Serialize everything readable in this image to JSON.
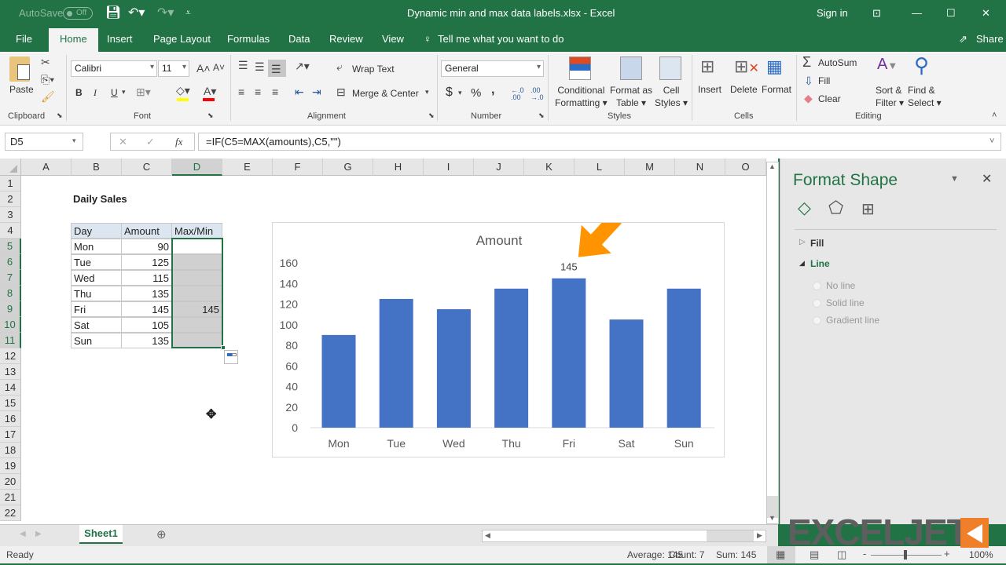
{
  "titlebar": {
    "autosave_label": "AutoSave",
    "autosave_state": "Off",
    "title": "Dynamic min and max data labels.xlsx  -  Excel",
    "sign_in": "Sign in"
  },
  "tabs": [
    "File",
    "Home",
    "Insert",
    "Page Layout",
    "Formulas",
    "Data",
    "Review",
    "View"
  ],
  "active_tab": "Home",
  "tell_me": "Tell me what you want to do",
  "share": "Share",
  "ribbon": {
    "clipboard": {
      "paste": "Paste",
      "label": "Clipboard"
    },
    "font": {
      "name": "Calibri",
      "size": "11",
      "label": "Font",
      "bold": "B",
      "italic": "I",
      "underline": "U",
      "fill_color": "#ffff00",
      "font_color": "#ff0000"
    },
    "alignment": {
      "wrap": "Wrap Text",
      "merge": "Merge & Center",
      "label": "Alignment"
    },
    "number": {
      "format": "General",
      "currency": "$",
      "percent": "%",
      "comma": ",",
      "label": "Number"
    },
    "styles": {
      "conditional": [
        "Conditional",
        "Formatting ▾"
      ],
      "table": [
        "Format as",
        "Table ▾"
      ],
      "cell": [
        "Cell",
        "Styles ▾"
      ],
      "label": "Styles"
    },
    "cells": {
      "insert": "Insert",
      "delete": "Delete",
      "format": "Format",
      "label": "Cells"
    },
    "editing": {
      "autosum": "AutoSum",
      "fill": "Fill",
      "clear": "Clear",
      "sort": [
        "Sort &",
        "Filter ▾"
      ],
      "find": [
        "Find &",
        "Select ▾"
      ],
      "label": "Editing"
    }
  },
  "formula_bar": {
    "name_box": "D5",
    "formula": "=IF(C5=MAX(amounts),C5,\"\")"
  },
  "columns": [
    "A",
    "B",
    "C",
    "D",
    "E",
    "F",
    "G",
    "H",
    "I",
    "J",
    "K",
    "L",
    "M",
    "N",
    "O"
  ],
  "selected_column": "D",
  "rows": [
    "1",
    "2",
    "3",
    "4",
    "5",
    "6",
    "7",
    "8",
    "9",
    "10",
    "11",
    "12",
    "13",
    "14",
    "15",
    "16",
    "17",
    "18",
    "19",
    "20",
    "21",
    "22"
  ],
  "sheet": {
    "title": "Daily Sales",
    "headers": [
      "Day",
      "Amount",
      "Max/Min"
    ],
    "data": [
      {
        "day": "Mon",
        "amount": "90",
        "maxmin": ""
      },
      {
        "day": "Tue",
        "amount": "125",
        "maxmin": ""
      },
      {
        "day": "Wed",
        "amount": "115",
        "maxmin": ""
      },
      {
        "day": "Thu",
        "amount": "135",
        "maxmin": ""
      },
      {
        "day": "Fri",
        "amount": "145",
        "maxmin": "145"
      },
      {
        "day": "Sat",
        "amount": "105",
        "maxmin": ""
      },
      {
        "day": "Sun",
        "amount": "135",
        "maxmin": ""
      }
    ]
  },
  "chart_data": {
    "type": "bar",
    "title": "Amount",
    "categories": [
      "Mon",
      "Tue",
      "Wed",
      "Thu",
      "Fri",
      "Sat",
      "Sun"
    ],
    "values": [
      90,
      125,
      115,
      135,
      145,
      105,
      135
    ],
    "data_labels": [
      null,
      null,
      null,
      null,
      "145",
      null,
      null
    ],
    "yticks": [
      "0",
      "20",
      "40",
      "60",
      "80",
      "100",
      "120",
      "140",
      "160"
    ],
    "ylim": [
      0,
      160
    ],
    "xlabel": "",
    "ylabel": "",
    "bar_color": "#4472c4",
    "annotation": "orange arrow pointing to Fri data label",
    "annotation_color": "#ff9400",
    "grid": false
  },
  "format_pane": {
    "title": "Format Shape",
    "sections": [
      {
        "label": "Fill",
        "expanded": false
      },
      {
        "label": "Line",
        "expanded": true
      }
    ],
    "line_options": [
      "No line",
      "Solid line",
      "Gradient line"
    ]
  },
  "sheet_tabs": [
    "Sheet1"
  ],
  "status": {
    "ready": "Ready",
    "average": "Average: 145",
    "count": "Count: 7",
    "sum": "Sum: 145",
    "zoom": "100%"
  },
  "watermark": "EXCELJET"
}
